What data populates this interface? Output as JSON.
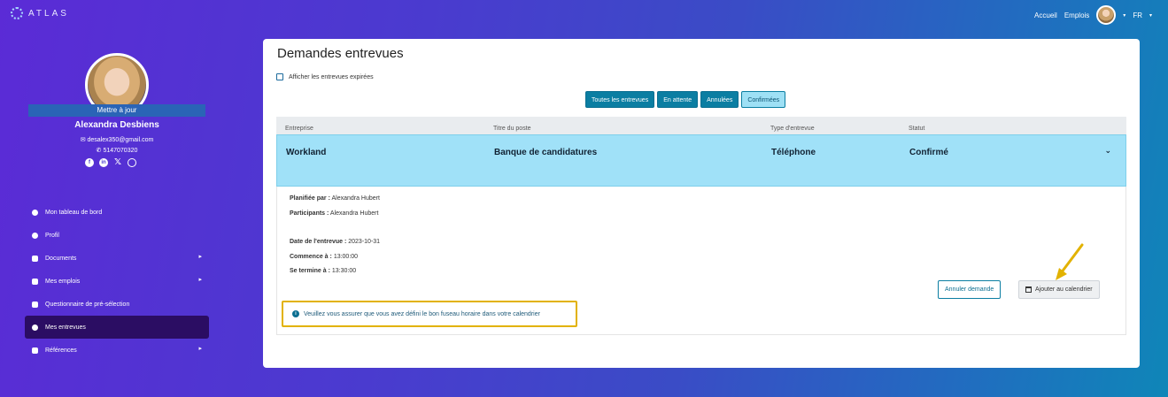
{
  "brand": {
    "name": "ATLAS"
  },
  "topnav": {
    "home": "Accueil",
    "jobs": "Emplois",
    "lang": "FR"
  },
  "profile": {
    "update_label": "Mettre à jour",
    "name": "Alexandra  Desbiens",
    "email": "desalex350@gmail.com",
    "phone": "5147070320",
    "socials": [
      "facebook-icon",
      "linkedin-icon",
      "x-icon",
      "globe-icon"
    ]
  },
  "menu": {
    "items": [
      {
        "label": "Mon tableau de bord",
        "icon": "dashboard-icon"
      },
      {
        "label": "Profil",
        "icon": "user-icon"
      },
      {
        "label": "Documents",
        "icon": "folder-icon"
      },
      {
        "label": "Mes emplois",
        "icon": "folder-icon"
      },
      {
        "label": "Questionnaire de pré-sélection",
        "icon": "checklist-icon"
      },
      {
        "label": "Mes entrevues",
        "icon": "clock-icon"
      },
      {
        "label": "Références",
        "icon": "users-icon"
      }
    ]
  },
  "page": {
    "title": "Demandes entrevues",
    "show_expired_label": "Afficher les entrevues expirées",
    "filters": [
      "Toutes les entrevues",
      "En attente",
      "Annulées",
      "Confirmées"
    ],
    "active_filter": "Confirmées"
  },
  "table": {
    "headers": [
      "Entreprise",
      "Titre du poste",
      "Type d'entrevue",
      "Statut"
    ],
    "row": {
      "company": "Workland",
      "job_title": "Banque de candidatures",
      "type": "Téléphone",
      "status": "Confirmé"
    }
  },
  "detail": {
    "planned_by_label": "Planifiée par :",
    "planned_by": "Alexandra Hubert",
    "participants_label": "Participants :",
    "participants": "Alexandra Hubert",
    "date_label": "Date de l'entrevue :",
    "date": "2023-10-31",
    "start_label": "Commence à :",
    "start": "13:00:00",
    "end_label": "Se termine à :",
    "end": "13:30:00",
    "warning": "Veuillez vous assurer que vous avez défini le bon fuseau horaire dans votre calendrier",
    "cancel_button": "Annuler demande",
    "add_calendar_button": "Ajouter au calendrier"
  },
  "colors": {
    "accent": "#0b7ea2",
    "highlight_row": "#a0e1f8",
    "sidebar_active": "#2b0d63",
    "annotation": "#e2b200"
  }
}
